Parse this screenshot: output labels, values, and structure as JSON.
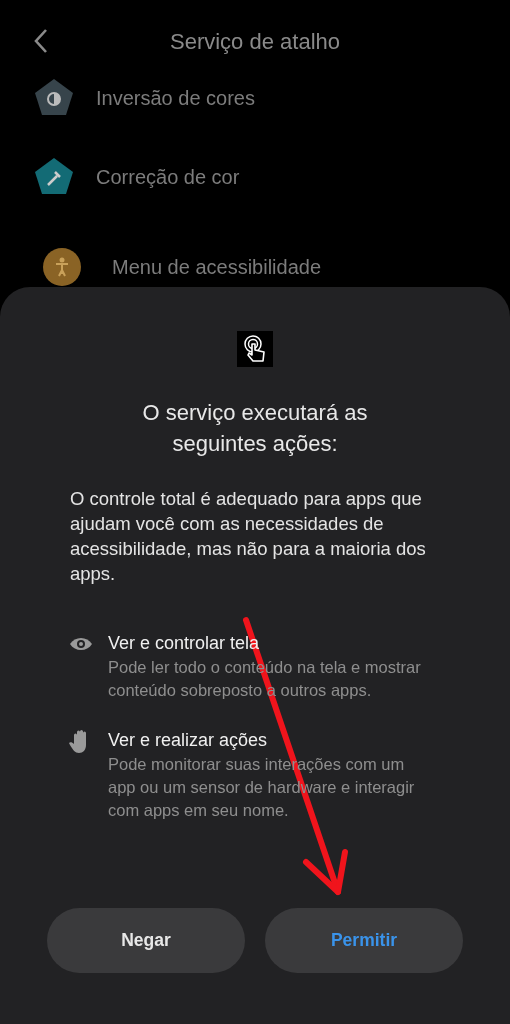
{
  "header": {
    "title": "Serviço de atalho"
  },
  "shortcuts": [
    {
      "label": "Inversão de cores",
      "kind": "pentagon",
      "color": "#37444b"
    },
    {
      "label": "Correção de cor",
      "kind": "pentagon",
      "color": "#136b75"
    },
    {
      "label": "Menu de acessibilidade",
      "kind": "circle",
      "color": "#8a6325"
    }
  ],
  "dialog": {
    "title": "O serviço executará as seguintes ações:",
    "body": "O controle total é adequado para apps que ajudam você com as necessidades de acessibilidade, mas não para a maioria dos apps.",
    "permissions": [
      {
        "kind": "eye",
        "title": "Ver e controlar tela",
        "description": "Pode ler todo o conteúdo na tela e mostrar conteúdo sobreposto a outros apps."
      },
      {
        "kind": "hand",
        "title": "Ver e realizar ações",
        "description": "Pode monitorar suas interações com um app ou um sensor de hardware e interagir com apps em seu nome."
      }
    ],
    "buttons": [
      {
        "label": "Negar",
        "kind": "secondary"
      },
      {
        "label": "Permitir",
        "kind": "primary"
      }
    ]
  }
}
